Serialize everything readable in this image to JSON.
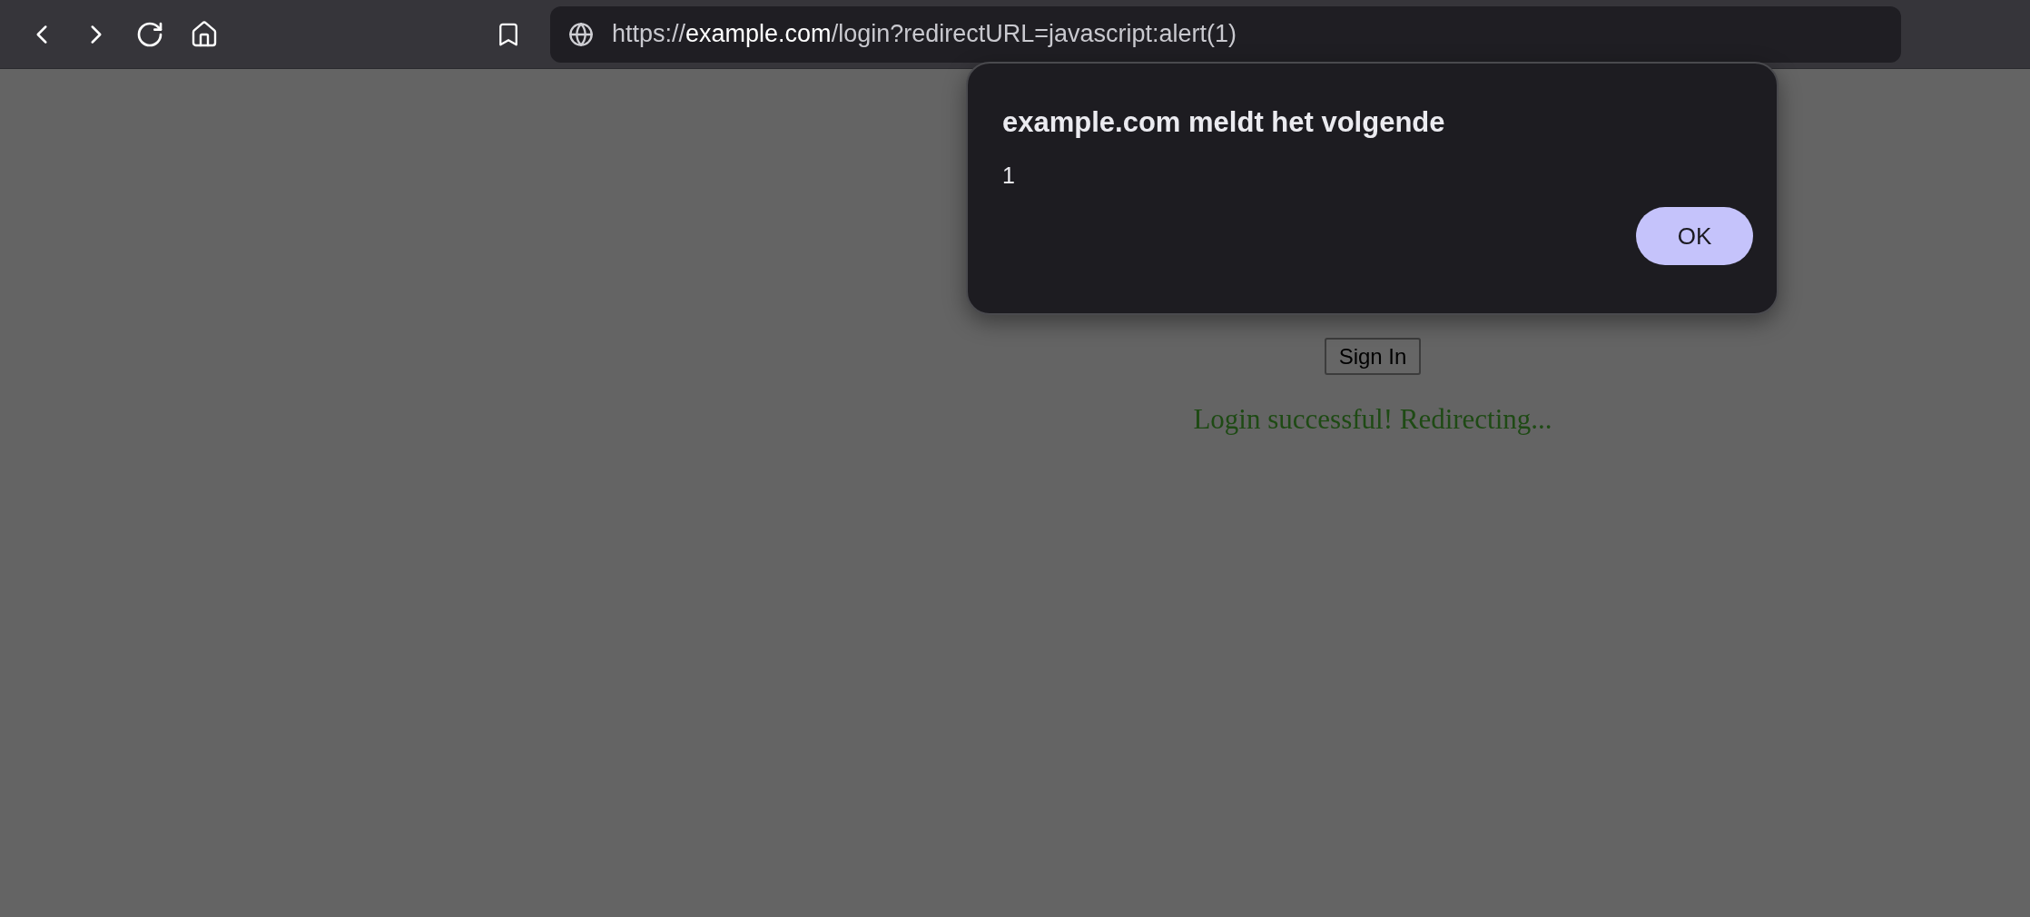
{
  "toolbar": {
    "address": {
      "scheme": "https://",
      "host": "example.com",
      "path": "/login?redirectURL=javascript:alert(1)"
    }
  },
  "page": {
    "sign_in_button": "Sign In",
    "status_message": "Login successful! Redirecting..."
  },
  "dialog": {
    "title": "example.com meldt het volgende",
    "message": "1",
    "buttons": [
      "OK"
    ]
  }
}
